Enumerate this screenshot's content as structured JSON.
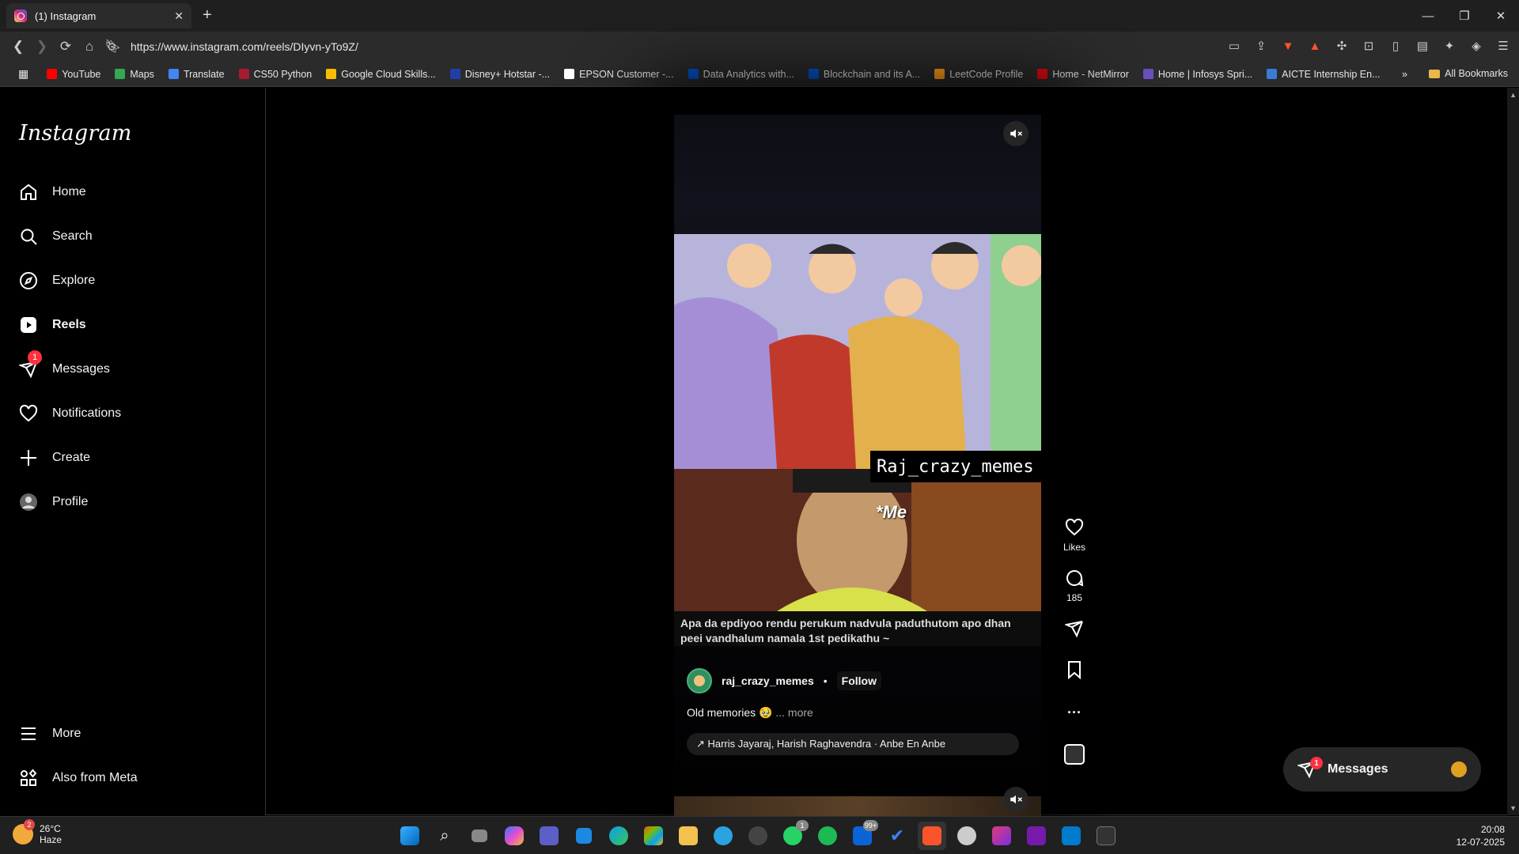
{
  "browser": {
    "tab_title": "(1) Instagram",
    "url": "https://www.instagram.com/reels/DIyvn-yTo9Z/",
    "bookmarks": [
      {
        "label": "YouTube",
        "color": "#ff0000"
      },
      {
        "label": "Maps",
        "color": "#34a853"
      },
      {
        "label": "Translate",
        "color": "#4285f4"
      },
      {
        "label": "CS50 Python",
        "color": "#a51c30"
      },
      {
        "label": "Google Cloud Skills...",
        "color": "#fbbc05"
      },
      {
        "label": "Disney+ Hotstar -...",
        "color": "#1f3fa8"
      },
      {
        "label": "EPSON Customer -...",
        "color": "#ffffff"
      },
      {
        "label": "Data Analytics with...",
        "color": "#0056d2"
      },
      {
        "label": "Blockchain and its A...",
        "color": "#0056d2"
      },
      {
        "label": "LeetCode Profile",
        "color": "#ffa116"
      },
      {
        "label": "Home - NetMirror",
        "color": "#e50914"
      },
      {
        "label": "Home | Infosys Spri...",
        "color": "#6b4fbb"
      },
      {
        "label": "AICTE Internship En...",
        "color": "#3a7bd5"
      }
    ],
    "all_bookmarks": "All Bookmarks"
  },
  "sidebar": {
    "logo": "Instagram",
    "items": [
      {
        "label": "Home",
        "icon": "home-icon"
      },
      {
        "label": "Search",
        "icon": "search-icon"
      },
      {
        "label": "Explore",
        "icon": "compass-icon"
      },
      {
        "label": "Reels",
        "icon": "reels-icon"
      },
      {
        "label": "Messages",
        "icon": "messenger-icon",
        "badge": "1"
      },
      {
        "label": "Notifications",
        "icon": "heart-icon"
      },
      {
        "label": "Create",
        "icon": "plus-icon"
      },
      {
        "label": "Profile",
        "icon": "avatar-icon"
      }
    ],
    "more": "More",
    "also_from_meta": "Also from Meta"
  },
  "reel": {
    "watermark": "Raj_crazy_memes",
    "me_label": "*Me",
    "caption_text": "Apa da epdiyoo rendu perukum nadvula paduthutom apo dhan peei vandhalum namala 1st pedikathu ~",
    "author": "raj_crazy_memes",
    "separator": "•",
    "follow": "Follow",
    "description": "Old memories 🥹",
    "more": "... more",
    "music": "↗ Harris Jayaraj, Harish Raghavendra · Anbe En Anbe",
    "likes_label": "Likes",
    "comments_count": "185"
  },
  "messages_pill": {
    "label": "Messages",
    "badge": "1"
  },
  "taskbar": {
    "temp": "26°C",
    "weather": "Haze",
    "weather_badge": "2",
    "time": "20:08",
    "date": "12-07-2025",
    "whatsapp_badge": "1",
    "outlook_badge": "99+"
  }
}
